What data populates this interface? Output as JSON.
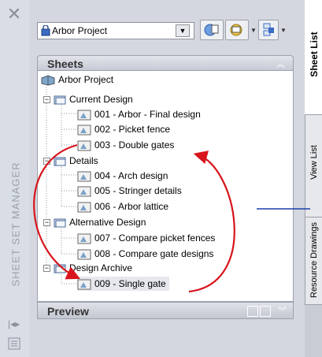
{
  "strip": {
    "title": "SHEET SET MANAGER"
  },
  "toolbar": {
    "project": "Arbor Project"
  },
  "sheets": {
    "title": "Sheets",
    "root": "Arbor Project",
    "subsets": [
      {
        "name": "Current Design",
        "sheets": [
          "001 - Arbor - Final design",
          "002 - Picket fence",
          "003 - Double gates"
        ]
      },
      {
        "name": "Details",
        "sheets": [
          "004 - Arch design",
          "005 - Stringer details",
          "006 - Arbor lattice"
        ]
      },
      {
        "name": "Alternative Design",
        "sheets": [
          "007 - Compare picket fences",
          "008 - Compare gate designs"
        ]
      },
      {
        "name": "Design Archive",
        "sheets": [
          "009 - Single gate"
        ]
      }
    ]
  },
  "preview": {
    "title": "Preview"
  },
  "tabs": {
    "sheet_list": "Sheet List",
    "view_list": "View List",
    "resource_drawings": "Resource Drawings"
  },
  "colors": {
    "annotation_arrow": "#d8141c",
    "callout_line": "#1a3fa8"
  }
}
